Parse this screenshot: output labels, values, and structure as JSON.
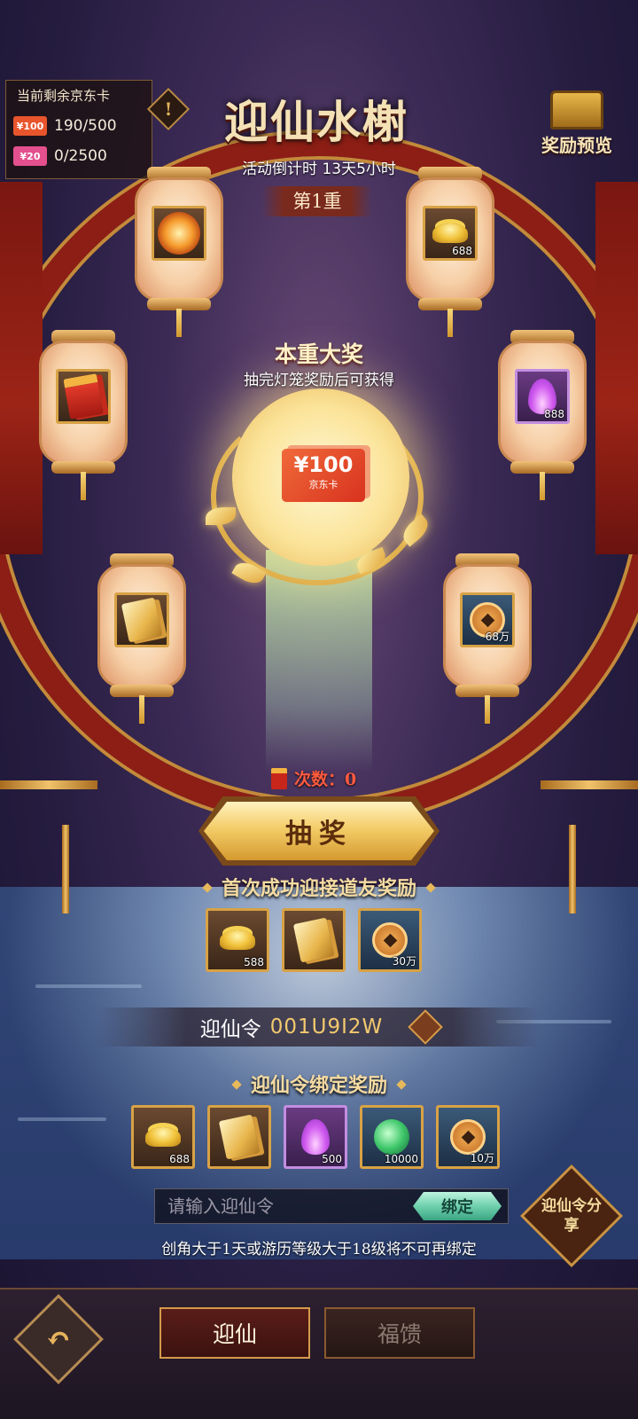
{
  "header": {
    "title": "迎仙水榭",
    "countdown": "活动倒计时 13天5小时",
    "stage": "第1重",
    "reward_preview": "奖励预览",
    "warn_icon": "!"
  },
  "remaining": {
    "title": "当前剩余京东卡",
    "cards": [
      {
        "badge": "¥100",
        "value": "190/500",
        "color": "#e8552c"
      },
      {
        "badge": "¥20",
        "value": "0/2500",
        "color": "#e3508d"
      }
    ]
  },
  "lanterns": [
    {
      "icon": "fire-orb-icon",
      "qty": ""
    },
    {
      "icon": "gold-ingot-icon",
      "qty": "688"
    },
    {
      "icon": "red-packet-icon",
      "qty": ""
    },
    {
      "icon": "purple-flame-icon",
      "qty": "888"
    },
    {
      "icon": "gold-ticket-icon",
      "qty": ""
    },
    {
      "icon": "copper-coin-icon",
      "qty": "68万"
    }
  ],
  "grand_prize": {
    "title": "本重大奖",
    "subtitle": "抽完灯笼奖励后可获得",
    "card_amount": "¥100",
    "card_name": "京东卡"
  },
  "draw": {
    "times_label": "次数：0",
    "button": "抽奖"
  },
  "first_reward": {
    "title": "首次成功迎接道友奖励",
    "items": [
      {
        "icon": "gold-ingot-icon",
        "qty": "588"
      },
      {
        "icon": "gold-ticket-icon",
        "qty": ""
      },
      {
        "icon": "copper-coin-icon",
        "qty": "30万"
      }
    ]
  },
  "invite_code": {
    "label": "迎仙令",
    "value": "001U9I2W"
  },
  "bind_reward": {
    "title": "迎仙令绑定奖励",
    "items": [
      {
        "icon": "gold-ingot-icon",
        "qty": "688"
      },
      {
        "icon": "gold-ticket-icon",
        "qty": ""
      },
      {
        "icon": "purple-flame-icon",
        "qty": "500"
      },
      {
        "icon": "green-orb-icon",
        "qty": "10000"
      },
      {
        "icon": "copper-coin-icon",
        "qty": "10万"
      }
    ]
  },
  "bind": {
    "placeholder": "请输入迎仙令",
    "button": "绑定",
    "note": "创角大于1天或游历等级大于18级将不可再绑定",
    "share": "迎仙令分享"
  },
  "bottom": {
    "back_icon": "↶",
    "tabs": [
      "迎仙",
      "福馈"
    ]
  }
}
